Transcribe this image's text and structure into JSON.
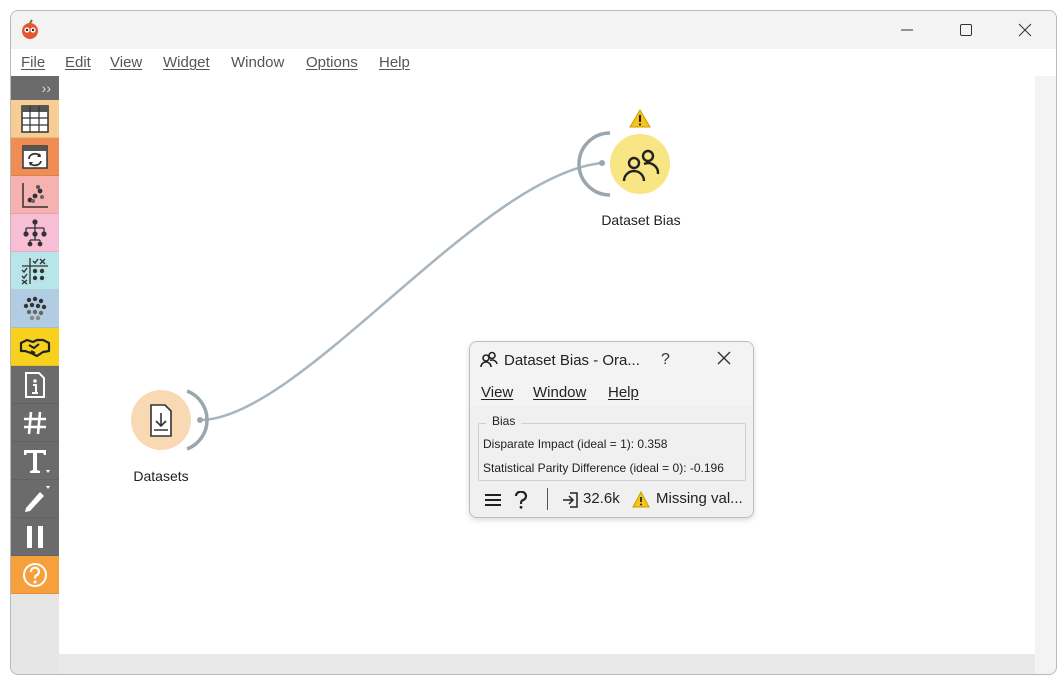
{
  "menu": {
    "file": "File",
    "edit": "Edit",
    "view": "View",
    "widget": "Widget",
    "window": "Window",
    "options": "Options",
    "help": "Help"
  },
  "toolbox": {
    "collapse_glyph": "››",
    "categories": [
      {
        "name": "data",
        "icon": "table-icon",
        "color": "#f7cd94"
      },
      {
        "name": "transform",
        "icon": "transform-icon",
        "color": "#ef8d55"
      },
      {
        "name": "visualize",
        "icon": "scatter-icon",
        "color": "#f6b2b1"
      },
      {
        "name": "model",
        "icon": "tree-icon",
        "color": "#f8bed6"
      },
      {
        "name": "evaluate",
        "icon": "check-grid-icon",
        "color": "#b8e5ea"
      },
      {
        "name": "unsupervised",
        "icon": "dots-cluster-icon",
        "color": "#b2cde3"
      },
      {
        "name": "fairness",
        "icon": "handshake-icon",
        "color": "#f7d11e"
      },
      {
        "name": "info",
        "icon": "info-icon",
        "color": "#6b6b6b"
      },
      {
        "name": "hash",
        "icon": "hash-icon",
        "color": "#6b6b6b"
      },
      {
        "name": "text",
        "icon": "text-icon",
        "color": "#6b6b6b"
      },
      {
        "name": "draw",
        "icon": "pen-icon",
        "color": "#6b6b6b"
      },
      {
        "name": "pause",
        "icon": "pause-icon",
        "color": "#6b6b6b"
      },
      {
        "name": "help",
        "icon": "help-circle-icon",
        "color": "#f6a03d"
      }
    ]
  },
  "canvas": {
    "nodes": {
      "datasets": {
        "label": "Datasets",
        "color": "#f9d9b4"
      },
      "dataset_bias": {
        "label": "Dataset Bias",
        "color": "#f7e683",
        "warning": true
      }
    }
  },
  "popup": {
    "title": "Dataset Bias - Ora...",
    "help_glyph": "?",
    "menu": {
      "view": "View",
      "window": "Window",
      "help": "Help"
    },
    "group_title": "Bias",
    "disparate_impact": "Disparate Impact (ideal = 1): 0.358",
    "statistical_parity": "Statistical Parity Difference (ideal = 0): -0.196",
    "status": {
      "count": "32.6k",
      "warning": "Missing val..."
    }
  }
}
